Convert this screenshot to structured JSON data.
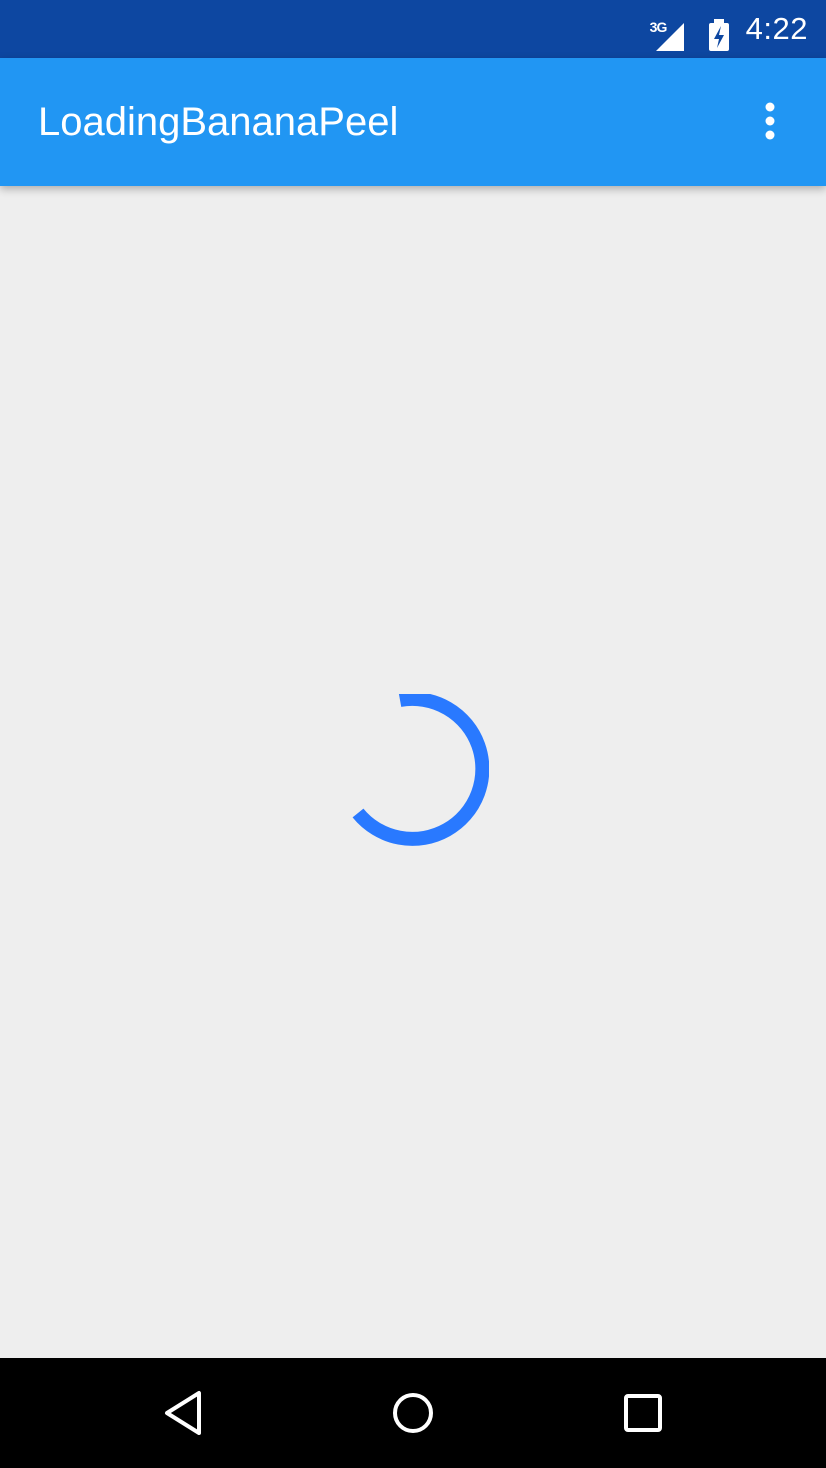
{
  "status_bar": {
    "network_type": "3G",
    "time": "4:22",
    "icons": [
      "signal-icon",
      "battery-charging-icon"
    ]
  },
  "app_bar": {
    "title": "LoadingBananaPeel",
    "overflow_icon": "more-vert-icon"
  },
  "content": {
    "indicator": "progress-spinner"
  },
  "nav_bar": {
    "icons": [
      "back-icon",
      "home-icon",
      "recents-icon"
    ]
  },
  "colors": {
    "status_bar": "#0d47a1",
    "app_bar": "#2196f3",
    "background": "#eeeeee",
    "spinner": "#2979ff",
    "nav_bar": "#000000"
  }
}
